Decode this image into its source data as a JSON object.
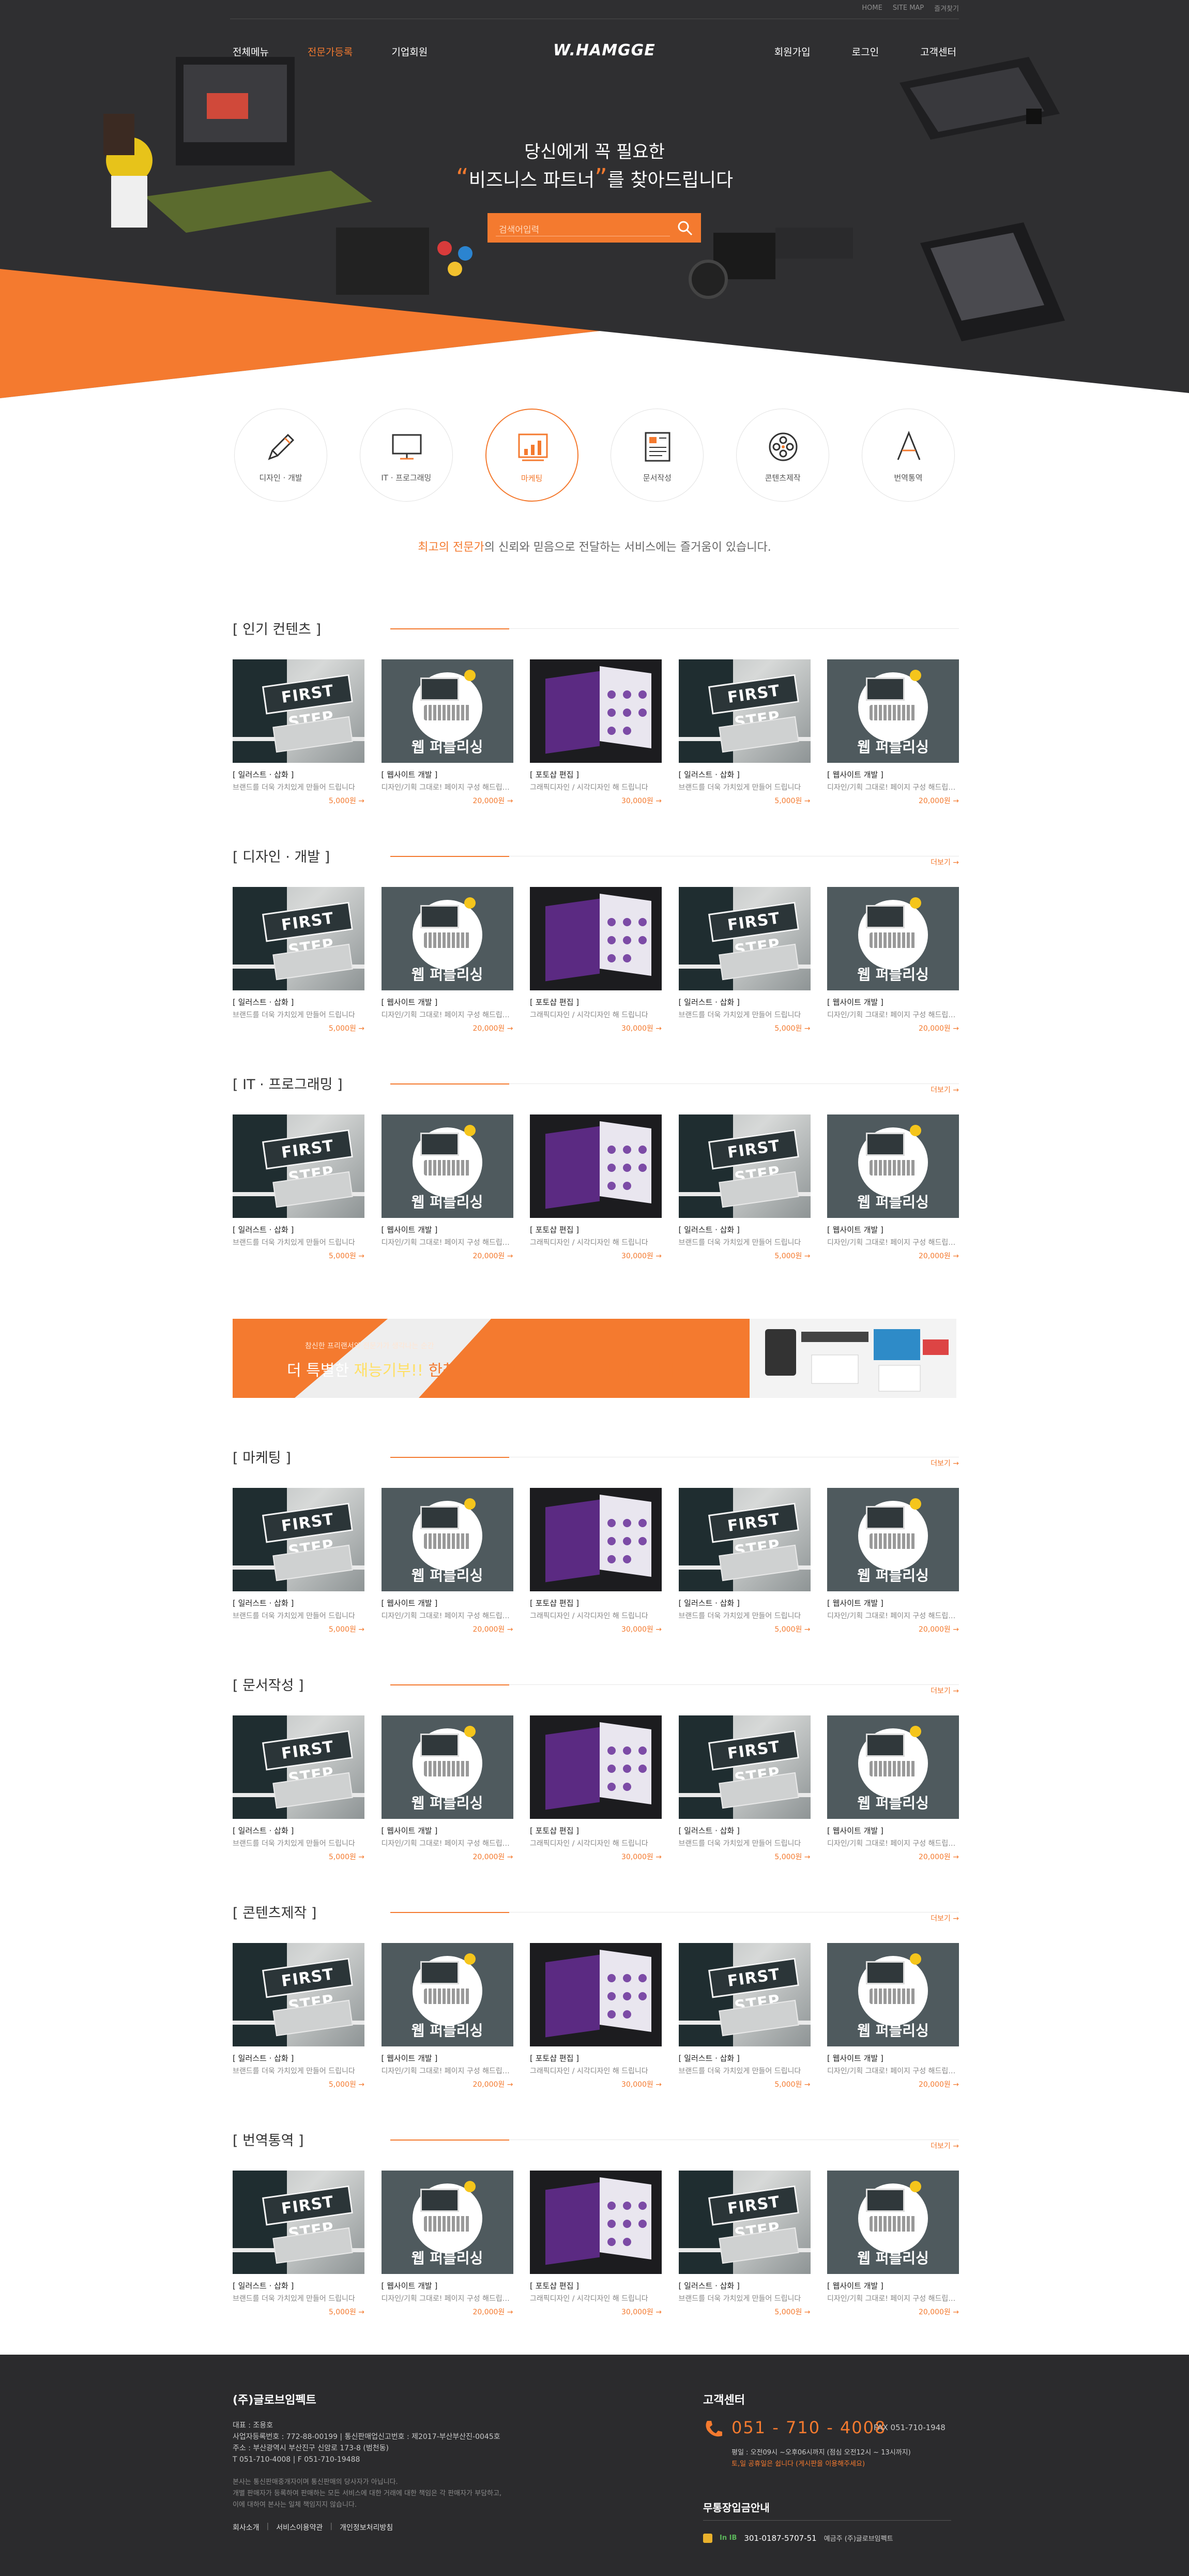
{
  "topbar": {
    "home": "HOME",
    "sitemap": "SITE MAP",
    "favorite": "즐겨찾기"
  },
  "nav": {
    "left": [
      "전체메뉴",
      "전문가등록",
      "기업회원"
    ],
    "right": [
      "회원가입",
      "로그인",
      "고객센터"
    ],
    "logo": "W.HAMGGE"
  },
  "hero": {
    "line1": "당신에게 꼭 필요한",
    "line2_quoted": "비즈니스 파트너",
    "line2_rest": "를 찾아드립니다",
    "search_placeholder": "검색어입력"
  },
  "categories": [
    {
      "label": "디자인 · 개발",
      "icon": "pencil-icon"
    },
    {
      "label": "IT · 프로그래밍",
      "icon": "monitor-icon"
    },
    {
      "label": "마케팅",
      "icon": "chart-icon"
    },
    {
      "label": "문서작성",
      "icon": "document-icon"
    },
    {
      "label": "콘텐츠제작",
      "icon": "film-reel-icon"
    },
    {
      "label": "번역통역",
      "icon": "letter-a-icon"
    }
  ],
  "tagline": {
    "highlight": "최고의 전문가",
    "rest": "의 신뢰와 믿음으로 전달하는 서비스에는 즐거움이 있습니다."
  },
  "more_label": "더보기 →",
  "cards": [
    {
      "title": "[ 일러스트 · 삽화 ]",
      "desc": "브랜드를 더욱 가치있게 만들어 드립니다",
      "price": "5,000원 →"
    },
    {
      "title": "[ 웹사이트 개발 ]",
      "desc": "디자인/기획 그대로! 페이지 구성 해드립니다",
      "price": "20,000원 →"
    },
    {
      "title": "[ 포토샵 편집 ]",
      "desc": "그래픽디자인 / 시각디자인 해 드립니다",
      "price": "30,000원 →"
    },
    {
      "title": "[ 일러스트 · 삽화 ]",
      "desc": "브랜드를 더욱 가치있게 만들어 드립니다",
      "price": "5,000원 →"
    },
    {
      "title": "[ 웹사이트 개발 ]",
      "desc": "디자인/기획 그대로! 페이지 구성 해드립니다",
      "price": "20,000원 →"
    }
  ],
  "thumb_text": {
    "sign": "FIRST STEP",
    "web": "웹 퍼블리싱"
  },
  "sections": [
    {
      "title": "[ 인기 컨텐츠 ]",
      "more": false
    },
    {
      "title": "[ 디자인 · 개발 ]",
      "more": true
    },
    {
      "title": "[ IT · 프로그래밍 ]",
      "more": true
    },
    {
      "title": "[ 마케팅 ]",
      "more": true
    },
    {
      "title": "[ 문서작성 ]",
      "more": true
    },
    {
      "title": "[ 콘텐츠제작 ]",
      "more": true
    },
    {
      "title": "[ 번역통역 ]",
      "more": true
    }
  ],
  "banner": {
    "small": "참신한 프리랜서와 전문가가 생각나는 순간",
    "prefix": "더 특별한 ",
    "highlight": "재능기부!!",
    "rest": " 한참 고민 하지말고 하루만에 해결하자!!"
  },
  "footer": {
    "company": "(주)글로브임펙트",
    "info": [
      "대표 : 조용호",
      "사업자등록번호 : 772-88-00199   |   통신판매업신고번호 : 제2017-부산부산진-0045호",
      "주소 : 부산광역시 부산진구 신암로 173-8 (범천동)",
      "T 051-710-4008   |   F 051-710-19488"
    ],
    "notes": [
      "본사는 통신판매중개자이며 통신판매의 당사자가 아닙니다.",
      "개별 판매자가 등록하여 판매하는 모든 서비스에 대한 거래에 대한 책임은 각 판매자가 부담하고,",
      "이에 대하여 본사는 일체 책임지지 않습니다."
    ],
    "links": [
      "회사소개",
      "서비스이용약관",
      "개인정보처리방침"
    ],
    "cc_title": "고객센터",
    "phone": "051 - 710 - 4008",
    "fax": "FAX 051-710-1948",
    "hours": "평일 : 오전09시 ~오후06시까지 (점심 오전12시 ~ 13시까지)",
    "hours2": "토,일 공휴일은 쉽니다 (게시판을 이용해주세요)",
    "bank_title": "무통장입금안내",
    "bank_name": "In IB",
    "bank_account": "301-0187-5707-51",
    "bank_holder": "예금주 (주)글로브임펙트"
  },
  "colors": {
    "accent": "#f47a2f",
    "hero_bg": "#2f2f31",
    "footer_bg": "#2b2b2d"
  }
}
